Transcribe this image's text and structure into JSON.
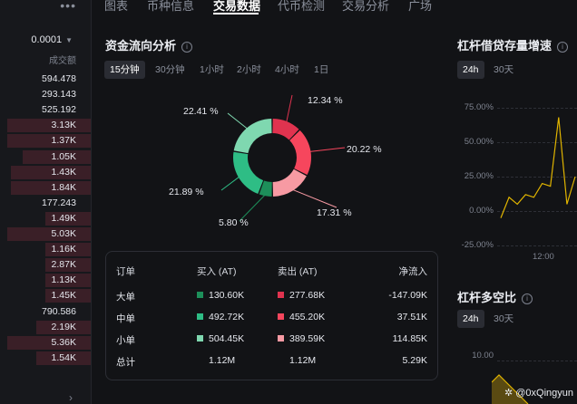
{
  "orderbook": {
    "menu_icon": "more-dots-icon",
    "precision": "0.0001",
    "column_header": "成交额",
    "rows": [
      {
        "value": "594.478",
        "depth": 0.0
      },
      {
        "value": "293.143",
        "depth": 0.0
      },
      {
        "value": "525.192",
        "depth": 0.0
      },
      {
        "value": "3.13K",
        "depth": 0.92
      },
      {
        "value": "1.37K",
        "depth": 0.92
      },
      {
        "value": "1.05K",
        "depth": 0.75
      },
      {
        "value": "1.43K",
        "depth": 0.88
      },
      {
        "value": "1.84K",
        "depth": 0.88
      },
      {
        "value": "177.243",
        "depth": 0.0
      },
      {
        "value": "1.49K",
        "depth": 0.5
      },
      {
        "value": "5.03K",
        "depth": 0.92
      },
      {
        "value": "1.16K",
        "depth": 0.5
      },
      {
        "value": "2.87K",
        "depth": 0.5
      },
      {
        "value": "1.13K",
        "depth": 0.5
      },
      {
        "value": "1.45K",
        "depth": 0.5
      },
      {
        "value": "790.586",
        "depth": 0.0
      },
      {
        "value": "2.19K",
        "depth": 0.6
      },
      {
        "value": "5.36K",
        "depth": 0.92
      },
      {
        "value": "1.54K",
        "depth": 0.6
      }
    ]
  },
  "tabs": [
    {
      "label": "图表",
      "active": false
    },
    {
      "label": "币种信息",
      "active": false
    },
    {
      "label": "交易数据",
      "active": true
    },
    {
      "label": "代币检测",
      "active": false
    },
    {
      "label": "交易分析",
      "active": false
    },
    {
      "label": "广场",
      "active": false
    }
  ],
  "flow": {
    "title": "资金流向分析",
    "timeframes": [
      "15分钟",
      "30分钟",
      "1小时",
      "2小时",
      "4小时",
      "1日"
    ],
    "active_timeframe": "15分钟",
    "chart_data": {
      "type": "pie",
      "title": "",
      "slices": [
        {
          "label": "12.34 %",
          "value": 12.34,
          "color": "#e0334f"
        },
        {
          "label": "20.22 %",
          "value": 20.22,
          "color": "#f6465d"
        },
        {
          "label": "17.31 %",
          "value": 17.31,
          "color": "#f79aa3"
        },
        {
          "label": "5.80 %",
          "value": 5.8,
          "color": "#1d8f5a"
        },
        {
          "label": "21.89 %",
          "value": 21.89,
          "color": "#2ebd85"
        },
        {
          "label": "22.41 %",
          "value": 22.41,
          "color": "#7fd8b0"
        }
      ]
    },
    "table": {
      "headers": [
        "订单",
        "买入 (AT)",
        "卖出 (AT)",
        "净流入"
      ],
      "rows": [
        {
          "type": "大单",
          "buy": "130.60K",
          "sell": "277.68K",
          "net": "-147.09K",
          "buy_color": "#1d8f5a",
          "sell_color": "#e0334f"
        },
        {
          "type": "中单",
          "buy": "492.72K",
          "sell": "455.20K",
          "net": "37.51K",
          "buy_color": "#2ebd85",
          "sell_color": "#f6465d"
        },
        {
          "type": "小单",
          "buy": "504.45K",
          "sell": "389.59K",
          "net": "114.85K",
          "buy_color": "#7fd8b0",
          "sell_color": "#f79aa3"
        }
      ],
      "total": {
        "type": "总计",
        "buy": "1.12M",
        "sell": "1.12M",
        "net": "5.29K"
      }
    }
  },
  "margin": {
    "title": "杠杆借贷存量增速",
    "timeframes": [
      "24h",
      "30天"
    ],
    "active_timeframe": "24h",
    "chart_data": {
      "type": "line",
      "title": "",
      "yticks": [
        "75.00%",
        "50.00%",
        "25.00%",
        "0.00%",
        "-25.00%"
      ],
      "ylim": [
        -25,
        75
      ],
      "xticks": [
        "12:00"
      ],
      "series": [
        {
          "values": [
            -5,
            10,
            5,
            12,
            10,
            20,
            18,
            68,
            5,
            25
          ],
          "color": "#e0b400"
        }
      ]
    }
  },
  "longshort": {
    "title": "杠杆多空比",
    "timeframes": [
      "24h",
      "30天"
    ],
    "active_timeframe": "24h",
    "ytick": "10.00"
  },
  "watermark": "@0xQingyun"
}
